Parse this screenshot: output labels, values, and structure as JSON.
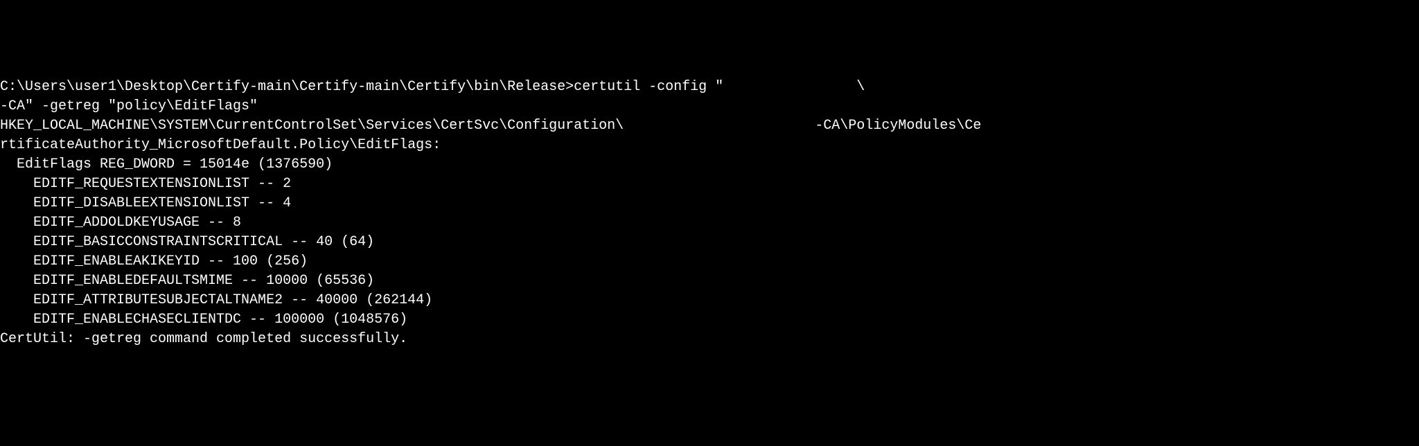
{
  "terminal": {
    "line1": "C:\\Users\\user1\\Desktop\\Certify-main\\Certify-main\\Certify\\bin\\Release>certutil -config \"                \\",
    "line2": "-CA\" -getreg \"policy\\EditFlags\"",
    "line3": "HKEY_LOCAL_MACHINE\\SYSTEM\\CurrentControlSet\\Services\\CertSvc\\Configuration\\                       -CA\\PolicyModules\\Ce",
    "line4": "rtificateAuthority_MicrosoftDefault.Policy\\EditFlags:",
    "line5": "",
    "line6": "  EditFlags REG_DWORD = 15014e (1376590)",
    "line7": "    EDITF_REQUESTEXTENSIONLIST -- 2",
    "line8": "    EDITF_DISABLEEXTENSIONLIST -- 4",
    "line9": "    EDITF_ADDOLDKEYUSAGE -- 8",
    "line10": "    EDITF_BASICCONSTRAINTSCRITICAL -- 40 (64)",
    "line11": "    EDITF_ENABLEAKIKEYID -- 100 (256)",
    "line12": "    EDITF_ENABLEDEFAULTSMIME -- 10000 (65536)",
    "line13": "    EDITF_ATTRIBUTESUBJECTALTNAME2 -- 40000 (262144)",
    "line14": "    EDITF_ENABLECHASECLIENTDC -- 100000 (1048576)",
    "line15": "CertUtil: -getreg command completed successfully."
  }
}
